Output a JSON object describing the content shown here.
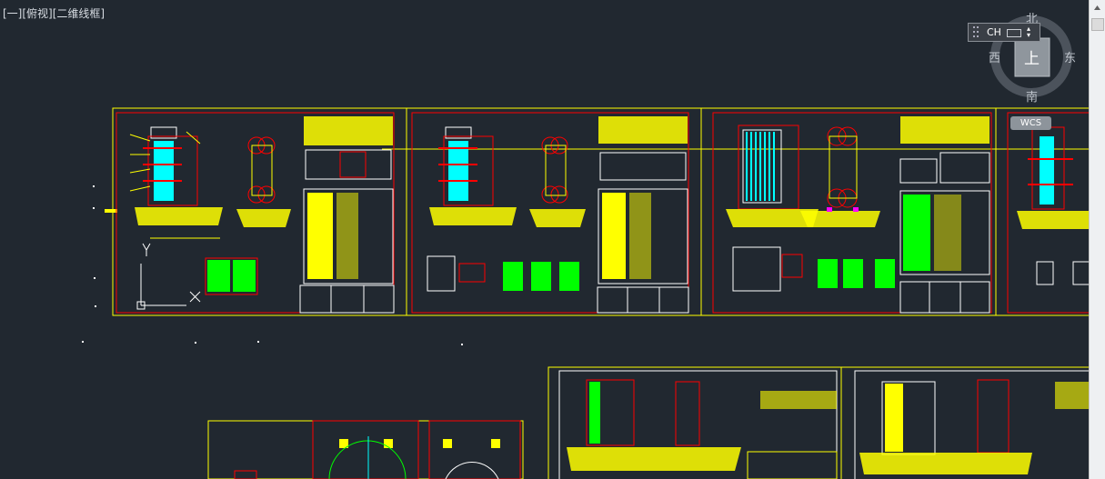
{
  "viewport_label": "[一][俯视][二维线框]",
  "viewcube": {
    "top_face": "上",
    "north": "北",
    "south": "南",
    "east": "东",
    "west": "西",
    "wcs": "WCS"
  },
  "ime": {
    "mode": "CH"
  },
  "colors": {
    "background": "#212830",
    "frame": "#ffff00",
    "border": "#ff0000",
    "accent": "#00ffff",
    "green": "#00ff00",
    "white": "#ffffff"
  }
}
